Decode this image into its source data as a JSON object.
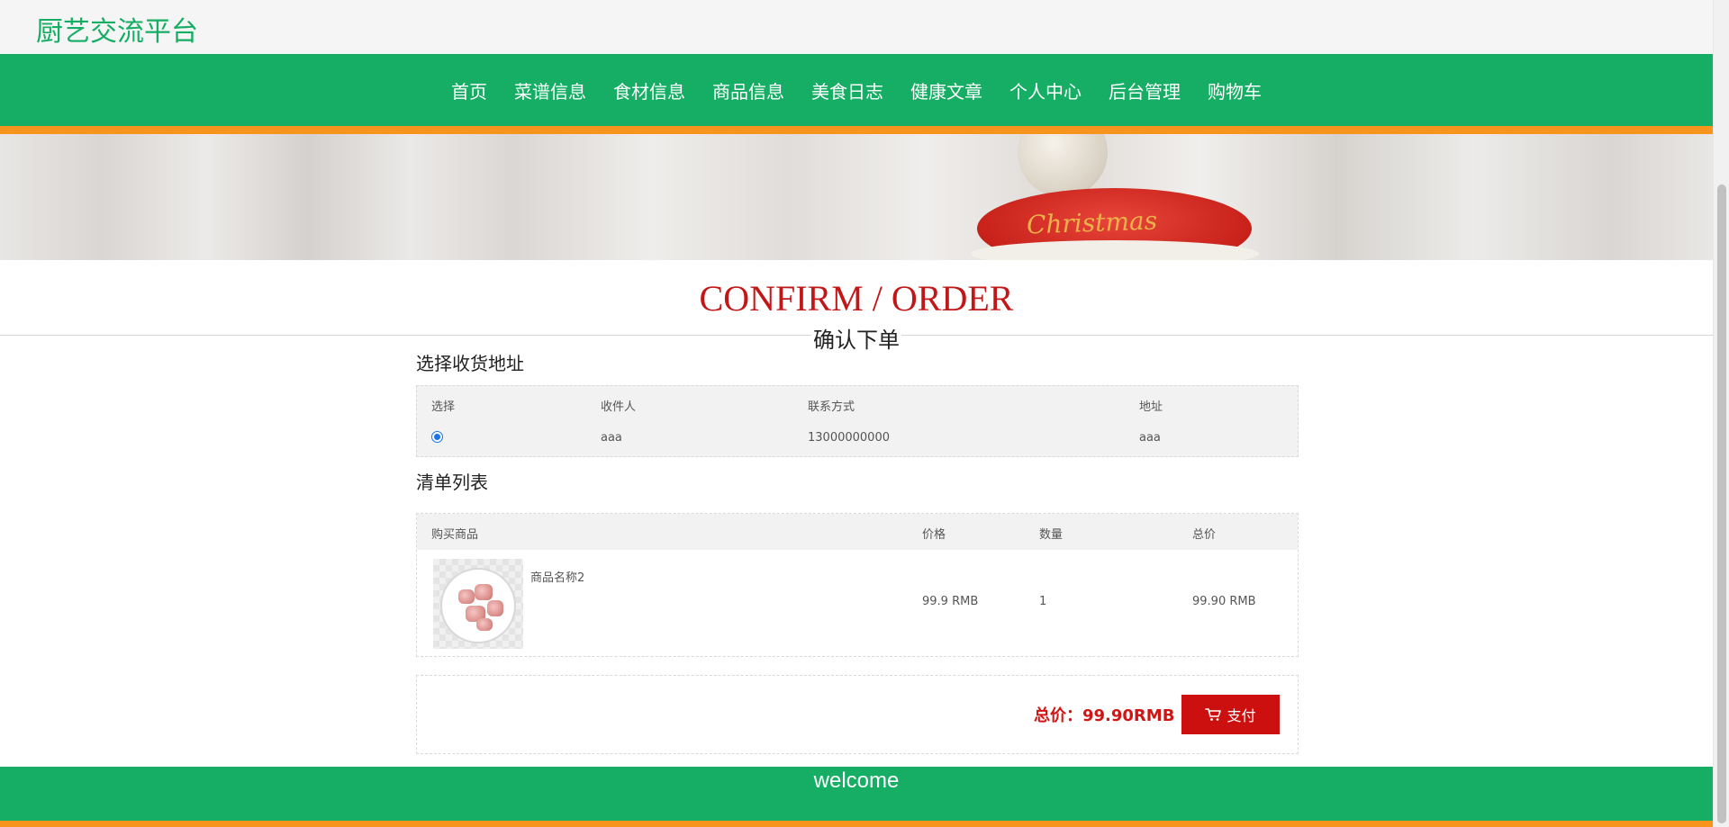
{
  "site": {
    "logo": "厨艺交流平台",
    "nav": [
      {
        "label": "首页"
      },
      {
        "label": "菜谱信息"
      },
      {
        "label": "食材信息"
      },
      {
        "label": "商品信息"
      },
      {
        "label": "美食日志"
      },
      {
        "label": "健康文章"
      },
      {
        "label": "个人中心"
      },
      {
        "label": "后台管理"
      },
      {
        "label": "购物车"
      }
    ],
    "banner_text": "Christmas"
  },
  "page": {
    "title_en": "CONFIRM / ORDER",
    "title_cn": "确认下单"
  },
  "address": {
    "section_title": "选择收货地址",
    "headers": {
      "select": "选择",
      "receiver": "收件人",
      "contact": "联系方式",
      "address": "地址"
    },
    "rows": [
      {
        "selected": true,
        "receiver": "aaa",
        "contact": "13000000000",
        "address": "aaa"
      }
    ]
  },
  "items": {
    "section_title": "清单列表",
    "headers": {
      "product": "购买商品",
      "price": "价格",
      "quantity": "数量",
      "total": "总价"
    },
    "rows": [
      {
        "name": "商品名称2",
        "price": "99.9 RMB",
        "quantity": "1",
        "total": "99.90 RMB",
        "image": "meat-plate-image"
      }
    ]
  },
  "payment": {
    "total_label": "总价：99.90RMB",
    "pay_button": "支付",
    "pay_icon": "cart-icon"
  },
  "footer": {
    "text": "welcome"
  },
  "colors": {
    "brand_green": "#16ad64",
    "accent_orange": "#f7941d",
    "title_red": "#c21717",
    "pay_red": "#cc0f0f"
  }
}
